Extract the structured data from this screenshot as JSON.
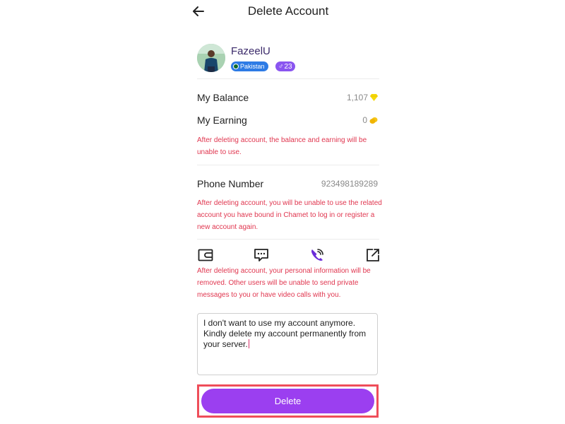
{
  "header": {
    "title": "Delete Account",
    "back_icon": "arrow-left-icon"
  },
  "profile": {
    "username": "FazeelU",
    "country": "Pakistan",
    "age": "23",
    "gender_symbol": "♂"
  },
  "balance": {
    "label": "My Balance",
    "value": "1,107",
    "icon": "diamond-icon",
    "icon_color": "#f5d90a"
  },
  "earning": {
    "label": "My Earning",
    "value": "0",
    "icon": "coins-icon",
    "icon_color": "#f5c518"
  },
  "warnings": {
    "balance": "After deleting account, the balance and earning will be unable to use.",
    "phone": "After deleting account, you will be unable to use the related account you have bound in Chamet to log in or register a new account again.",
    "personal": "After deleting account, your personal information will be removed. Other users will be unable to send private messages to you or have video calls with you."
  },
  "phone": {
    "label": "Phone Number",
    "value": "923498189289"
  },
  "feature_icons": [
    "wallet-icon",
    "chat-icon",
    "phone-call-icon",
    "external-link-icon"
  ],
  "reason": {
    "text": "I don't want to use my account anymore. Kindly delete my account permanently from your server."
  },
  "delete_button": {
    "label": "Delete",
    "color": "#9b3ff0"
  },
  "colors": {
    "warning": "#e0364f",
    "accent": "#9b3ff0",
    "highlight": "#ef4e5a"
  }
}
